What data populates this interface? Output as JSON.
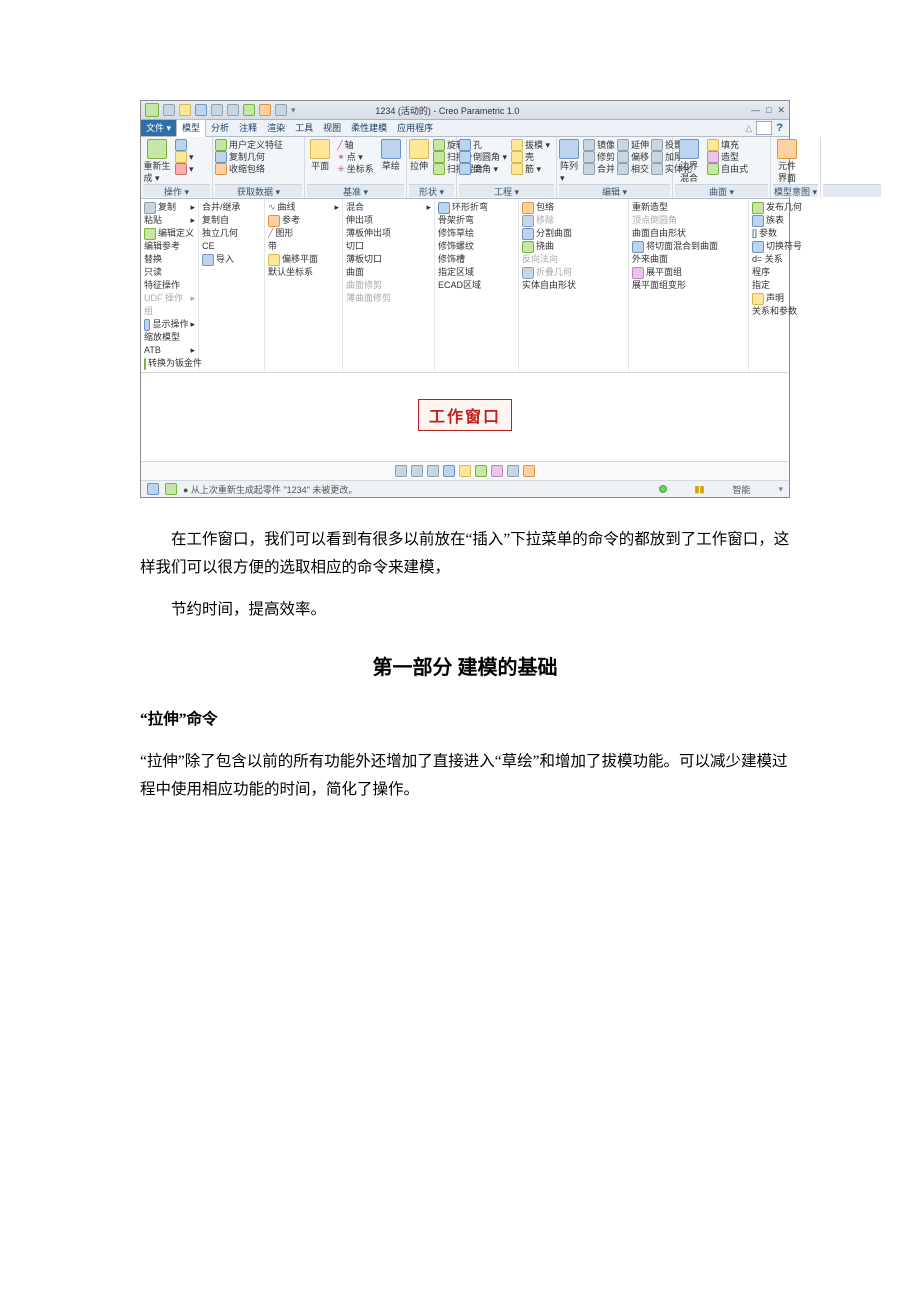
{
  "titlebar": {
    "title": "1234 (活动的) - Creo Parametric 1.0",
    "win": {
      "min": "—",
      "max": "□",
      "close": "✕"
    }
  },
  "tabs": {
    "file": "文件 ▾",
    "items": [
      "模型",
      "分析",
      "注释",
      "渲染",
      "工具",
      "视图",
      "柔性建模",
      "应用程序"
    ],
    "help_tip": "?"
  },
  "ribbon": {
    "g0": {
      "label": "操作 ▾",
      "regen": "重新生\n成 ▾",
      "items": [
        "复制",
        "粘贴",
        "×"
      ]
    },
    "g1": {
      "label": "获取数据 ▾",
      "items": [
        "用户定义特征",
        "复制几何",
        "收缩包络"
      ]
    },
    "g2": {
      "label": "基准 ▾",
      "plane": "平面",
      "items_r1": [
        "轴",
        "点 ▾",
        "坐标系"
      ],
      "sketch": "草绘"
    },
    "g3": {
      "label": "形状 ▾",
      "extrude": "拉伸",
      "items": [
        "旋转",
        "扫描 ▾",
        "扫描混合"
      ]
    },
    "g4": {
      "label": "工程 ▾",
      "items": [
        "孔",
        "倒圆角 ▾",
        "倒角 ▾",
        "拔模 ▾",
        "壳",
        "筋 ▾"
      ]
    },
    "g5": {
      "label": "编辑 ▾",
      "pattern": "阵列\n▾",
      "items": [
        "镜像",
        "修剪",
        "合并",
        "延伸",
        "偏移",
        "相交",
        "投影",
        "加厚",
        "实体化"
      ]
    },
    "g6": {
      "label": "曲面 ▾",
      "bm": "边界\n混合",
      "items": [
        "填充",
        "造型",
        "自由式"
      ]
    },
    "g7": {
      "label": "模型意图 ▾",
      "items_top": "元件\n界面"
    }
  },
  "menu_cols": {
    "c0": [
      "复制",
      "粘贴",
      "编辑定义",
      "编辑参考",
      "替换",
      "只读",
      "特征操作",
      "UDF 操作",
      "组",
      "显示操作",
      "缩放模型",
      "ATB",
      "转换为钣金件"
    ],
    "c1": [
      "合并/继承",
      "复制自",
      "独立几何",
      "CE",
      "导入"
    ],
    "c2": [
      "曲线",
      "参考",
      "图形",
      "带",
      "偏移平面",
      "默认坐标系"
    ],
    "c3_head": "混合",
    "c3": [
      "伸出项",
      "薄板伸出项",
      "切口",
      "薄板切口",
      "曲面",
      "曲面修剪",
      "薄曲面修剪"
    ],
    "c4": [
      "环形折弯",
      "骨架折弯",
      "修饰草绘",
      "修饰螺纹",
      "修饰槽",
      "指定区域",
      "ECAD区域"
    ],
    "c5": [
      "包络",
      "移除",
      "分割曲面",
      "挠曲",
      "反向法向",
      "折叠几何",
      "实体自由形状"
    ],
    "c6": [
      "重新造型",
      "顶点倒圆角",
      "曲面自由形状",
      "将切面混合到曲面",
      "外来曲面",
      "展平面组",
      "展平面组变形"
    ],
    "c7": [
      "发布几何",
      "族表",
      "参数",
      "切换符号",
      "d= 关系",
      "程序",
      "指定",
      "声明",
      "关系和参数"
    ]
  },
  "work_label": "工作窗口",
  "status": {
    "msg": "● 从上次重新生成起零件 \"1234\" 未被更改。",
    "mode": "智能"
  },
  "body": {
    "p1": "在工作窗口，我们可以看到有很多以前放在“插入”下拉菜单的命令的都放到了工作窗口，这样我们可以很方便的选取相应的命令来建模，",
    "p2": "节约时间，提高效率。",
    "h2": "第一部分 建模的基础",
    "h3": "“拉伸”命令",
    "p3": "“拉伸”除了包含以前的所有功能外还增加了直接进入“草绘”和增加了拔模功能。可以减少建模过程中使用相应功能的时间，简化了操作。"
  }
}
